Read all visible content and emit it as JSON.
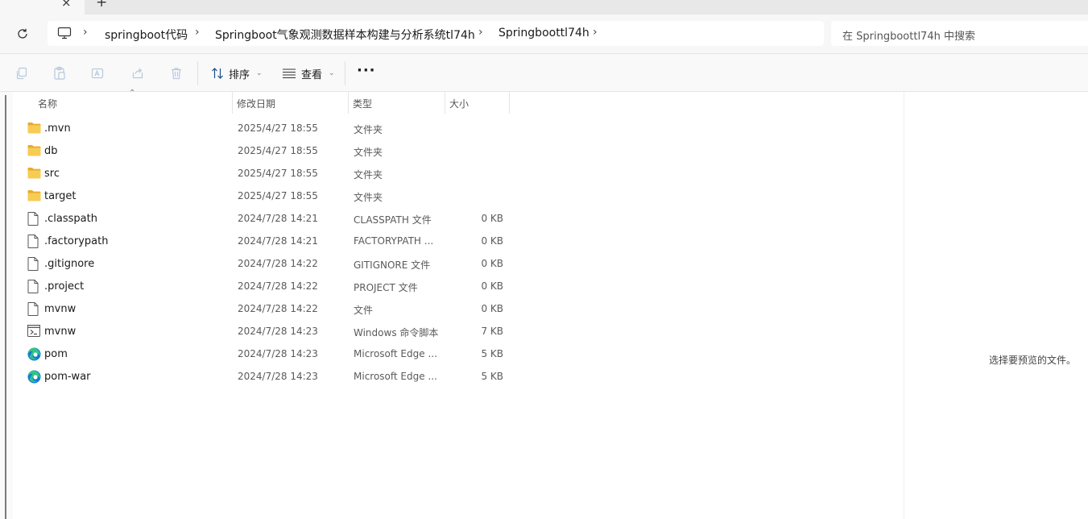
{
  "tabstrip": {
    "close_glyph": "×",
    "new_tab_glyph": "+"
  },
  "nav": {
    "refresh_icon": "refresh-icon",
    "location_icon": "this-pc-icon",
    "breadcrumb": [
      {
        "label": "springboot代码"
      },
      {
        "label": "Springboot气象观测数据样本构建与分析系统tl74h"
      },
      {
        "label": "Springboottl74h"
      }
    ],
    "search_placeholder": "在 Springboottl74h 中搜索"
  },
  "toolbar": {
    "sort_label": "排序",
    "view_label": "查看",
    "more_label": "···"
  },
  "columns": {
    "name": "名称",
    "modified": "修改日期",
    "type": "类型",
    "size": "大小"
  },
  "files": [
    {
      "name": ".mvn",
      "modified": "2025/4/27 18:55",
      "type": "文件夹",
      "size": "",
      "icon": "folder"
    },
    {
      "name": "db",
      "modified": "2025/4/27 18:55",
      "type": "文件夹",
      "size": "",
      "icon": "folder"
    },
    {
      "name": "src",
      "modified": "2025/4/27 18:55",
      "type": "文件夹",
      "size": "",
      "icon": "folder"
    },
    {
      "name": "target",
      "modified": "2025/4/27 18:55",
      "type": "文件夹",
      "size": "",
      "icon": "folder"
    },
    {
      "name": ".classpath",
      "modified": "2024/7/28 14:21",
      "type": "CLASSPATH 文件",
      "size": "0 KB",
      "icon": "file"
    },
    {
      "name": ".factorypath",
      "modified": "2024/7/28 14:21",
      "type": "FACTORYPATH ...",
      "size": "0 KB",
      "icon": "file"
    },
    {
      "name": ".gitignore",
      "modified": "2024/7/28 14:22",
      "type": "GITIGNORE 文件",
      "size": "0 KB",
      "icon": "file"
    },
    {
      "name": ".project",
      "modified": "2024/7/28 14:22",
      "type": "PROJECT 文件",
      "size": "0 KB",
      "icon": "file"
    },
    {
      "name": "mvnw",
      "modified": "2024/7/28 14:22",
      "type": "文件",
      "size": "0 KB",
      "icon": "file"
    },
    {
      "name": "mvnw",
      "modified": "2024/7/28 14:23",
      "type": "Windows 命令脚本",
      "size": "7 KB",
      "icon": "script"
    },
    {
      "name": "pom",
      "modified": "2024/7/28 14:23",
      "type": "Microsoft Edge ...",
      "size": "5 KB",
      "icon": "edge"
    },
    {
      "name": "pom-war",
      "modified": "2024/7/28 14:23",
      "type": "Microsoft Edge ...",
      "size": "5 KB",
      "icon": "edge"
    }
  ],
  "preview": {
    "empty_text": "选择要预览的文件。"
  },
  "colors": {
    "folder": "#f4c542",
    "edge_blue": "#0f7bd8",
    "edge_green": "#33c481"
  }
}
